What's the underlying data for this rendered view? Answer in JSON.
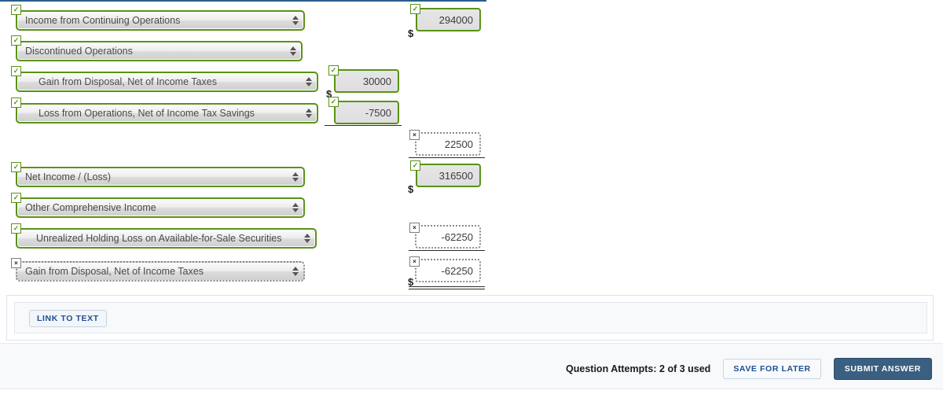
{
  "colors": {
    "correct_border": "#5a9216",
    "wrong_border": "#8a8a8a",
    "accent_blue": "#1d4f91",
    "submit_bg": "#3a5f80",
    "top_rule": "#2b5d8c"
  },
  "worksheet": {
    "rows": [
      {
        "id": "income-from-continuing-operations",
        "label": "Income from Continuing Operations",
        "label_status": "correct",
        "label_badge": "✓",
        "indent": 0,
        "value": "294000",
        "value_status": "correct",
        "value_badge": "✓",
        "value_column": "right",
        "dollar": "$"
      },
      {
        "id": "discontinued-operations",
        "label": "Discontinued Operations",
        "label_status": "correct",
        "label_badge": "✓",
        "indent": 0,
        "value": null,
        "value_status": null,
        "value_badge": null,
        "value_column": null,
        "dollar": null
      },
      {
        "id": "gain-from-disposal-net-of-income-taxes",
        "label": "Gain from Disposal, Net of Income Taxes",
        "label_status": "correct",
        "label_badge": "✓",
        "indent": 1,
        "value": "30000",
        "value_status": "correct",
        "value_badge": "✓",
        "value_column": "middle",
        "dollar": "$"
      },
      {
        "id": "loss-from-operations-net-of-income-tax-savings",
        "label": "Loss from Operations, Net of Income Tax Savings",
        "label_status": "correct",
        "label_badge": "✓",
        "indent": 1,
        "value": "-7500",
        "value_status": "correct",
        "value_badge": "✓",
        "value_column": "middle",
        "dollar": null
      },
      {
        "id": "discontinued-operations-subtotal",
        "label": null,
        "label_status": null,
        "label_badge": null,
        "indent": 0,
        "value": "22500",
        "value_status": "wrong",
        "value_badge": "×",
        "value_column": "right",
        "dollar": null
      },
      {
        "id": "net-income-loss",
        "label": "Net Income / (Loss)",
        "label_status": "correct",
        "label_badge": "✓",
        "indent": 0,
        "value": "316500",
        "value_status": "correct",
        "value_badge": "✓",
        "value_column": "right",
        "dollar": "$"
      },
      {
        "id": "other-comprehensive-income",
        "label": "Other Comprehensive Income",
        "label_status": "correct",
        "label_badge": "✓",
        "indent": 0,
        "value": null,
        "value_status": null,
        "value_badge": null,
        "value_column": null,
        "dollar": null
      },
      {
        "id": "unrealized-holding-loss-on-available-for-sale-securities",
        "label": "Unrealized Holding Loss on Available-for-Sale Securities",
        "label_status": "correct",
        "label_badge": "✓",
        "indent": 1,
        "value": "-62250",
        "value_status": "wrong",
        "value_badge": "×",
        "value_column": "right",
        "dollar": null
      },
      {
        "id": "gain-from-disposal-net-of-income-taxes-2",
        "label": "Gain from Disposal, Net of Income Taxes",
        "label_status": "wrong",
        "label_badge": "×",
        "indent": 0,
        "value": "-62250",
        "value_status": "wrong",
        "value_badge": "×",
        "value_column": "right",
        "dollar": "$"
      }
    ]
  },
  "link_to_text": {
    "button_label": "LINK TO TEXT"
  },
  "footer": {
    "attempts_text": "Question Attempts: 2 of 3 used",
    "save_label": "SAVE FOR LATER",
    "submit_label": "SUBMIT ANSWER"
  }
}
